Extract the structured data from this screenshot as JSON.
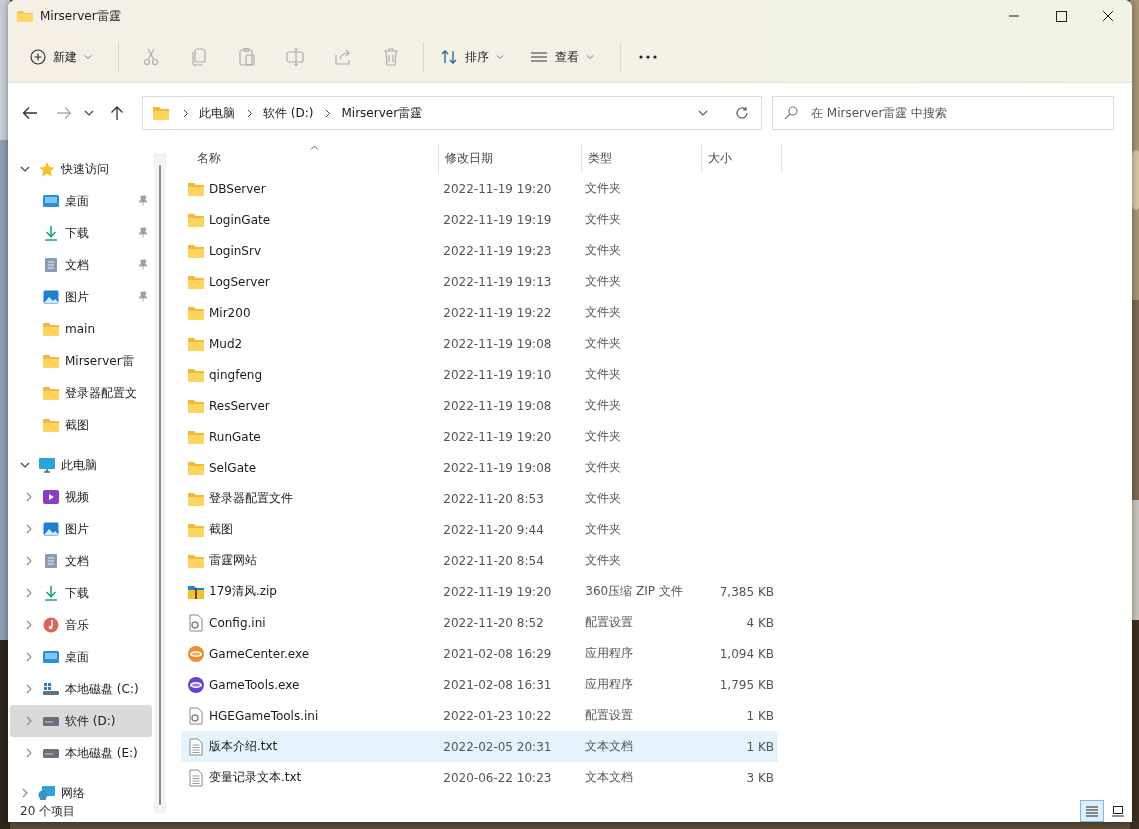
{
  "window": {
    "title": "Mirserver雷霆"
  },
  "toolbar": {
    "items": [
      {
        "kind": "new",
        "label": "新建",
        "disabled": false
      },
      {
        "kind": "cut",
        "disabled": true
      },
      {
        "kind": "copy",
        "disabled": true
      },
      {
        "kind": "paste",
        "disabled": true
      },
      {
        "kind": "rename",
        "disabled": true
      },
      {
        "kind": "share",
        "disabled": true
      },
      {
        "kind": "delete",
        "disabled": true
      },
      {
        "kind": "sort",
        "label": "排序",
        "disabled": false
      },
      {
        "kind": "view",
        "label": "查看",
        "disabled": false
      },
      {
        "kind": "more"
      }
    ]
  },
  "navigation": {
    "back_disabled": false,
    "forward_disabled": true,
    "breadcrumb": [
      "此电脑",
      "软件 (D:)",
      "Mirserver雷霆"
    ],
    "search": {
      "placeholder": "在 Mirserver雷霆 中搜索"
    }
  },
  "sidebar": {
    "items": [
      {
        "kind": "star",
        "label": "快速访问",
        "expanded": true,
        "selected": false,
        "children": [
          {
            "kind": "desktop",
            "label": "桌面",
            "pinned": true,
            "selected": false
          },
          {
            "kind": "download",
            "label": "下载",
            "pinned": true,
            "selected": false
          },
          {
            "kind": "doc",
            "label": "文档",
            "pinned": true,
            "selected": false
          },
          {
            "kind": "picture",
            "label": "图片",
            "pinned": true,
            "selected": false
          },
          {
            "kind": "folder",
            "label": "main",
            "pinned": false,
            "selected": false
          },
          {
            "kind": "folder",
            "label": "Mirserver雷",
            "pinned": false,
            "selected": false
          },
          {
            "kind": "folder",
            "label": "登录器配置文",
            "pinned": false,
            "selected": false
          },
          {
            "kind": "folder",
            "label": "截图",
            "pinned": false,
            "selected": false
          }
        ]
      },
      {
        "kind": "pc",
        "label": "此电脑",
        "expanded": true,
        "selected": false,
        "children": [
          {
            "kind": "video",
            "label": "视频",
            "expanded": false,
            "selected": false
          },
          {
            "kind": "picture",
            "label": "图片",
            "expanded": false,
            "selected": false
          },
          {
            "kind": "doc",
            "label": "文档",
            "expanded": false,
            "selected": false
          },
          {
            "kind": "download",
            "label": "下载",
            "expanded": false,
            "selected": false
          },
          {
            "kind": "music",
            "label": "音乐",
            "expanded": false,
            "selected": false
          },
          {
            "kind": "desktop",
            "label": "桌面",
            "expanded": false,
            "selected": false
          },
          {
            "kind": "drive-c",
            "label": "本地磁盘 (C:)",
            "expanded": false,
            "selected": false
          },
          {
            "kind": "drive",
            "label": "软件 (D:)",
            "expanded": false,
            "selected": true
          },
          {
            "kind": "drive",
            "label": "本地磁盘 (E:)",
            "expanded": false,
            "selected": false
          }
        ]
      },
      {
        "kind": "network",
        "label": "网络",
        "expanded": false,
        "selected": false
      }
    ]
  },
  "file_list": {
    "columns": [
      {
        "label": "名称",
        "sorted": true
      },
      {
        "label": "修改日期",
        "sorted": false
      },
      {
        "label": "类型",
        "sorted": false
      },
      {
        "label": "大小",
        "sorted": false
      }
    ],
    "rows": [
      {
        "kind": "folder",
        "name": "DBServer",
        "modified": "2022-11-19 19:20",
        "type": "文件夹",
        "hovered": false
      },
      {
        "kind": "folder",
        "name": "LoginGate",
        "modified": "2022-11-19 19:19",
        "type": "文件夹",
        "hovered": false
      },
      {
        "kind": "folder",
        "name": "LoginSrv",
        "modified": "2022-11-19 19:23",
        "type": "文件夹",
        "hovered": false
      },
      {
        "kind": "folder",
        "name": "LogServer",
        "modified": "2022-11-19 19:13",
        "type": "文件夹",
        "hovered": false
      },
      {
        "kind": "folder",
        "name": "Mir200",
        "modified": "2022-11-19 19:22",
        "type": "文件夹",
        "hovered": false
      },
      {
        "kind": "folder",
        "name": "Mud2",
        "modified": "2022-11-19 19:08",
        "type": "文件夹",
        "hovered": false
      },
      {
        "kind": "folder",
        "name": "qingfeng",
        "modified": "2022-11-19 19:10",
        "type": "文件夹",
        "hovered": false
      },
      {
        "kind": "folder",
        "name": "ResServer",
        "modified": "2022-11-19 19:08",
        "type": "文件夹",
        "hovered": false
      },
      {
        "kind": "folder",
        "name": "RunGate",
        "modified": "2022-11-19 19:20",
        "type": "文件夹",
        "hovered": false
      },
      {
        "kind": "folder",
        "name": "SelGate",
        "modified": "2022-11-19 19:08",
        "type": "文件夹",
        "hovered": false
      },
      {
        "kind": "folder",
        "name": "登录器配置文件",
        "modified": "2022-11-20 8:53",
        "type": "文件夹",
        "hovered": false
      },
      {
        "kind": "folder",
        "name": "截图",
        "modified": "2022-11-20 9:44",
        "type": "文件夹",
        "hovered": false
      },
      {
        "kind": "folder",
        "name": "雷霆网站",
        "modified": "2022-11-20 8:54",
        "type": "文件夹",
        "hovered": false
      },
      {
        "kind": "zip",
        "name": "179清风.zip",
        "modified": "2022-11-19 19:20",
        "type": "360压缩 ZIP 文件",
        "size": "7,385 KB",
        "hovered": false
      },
      {
        "kind": "ini",
        "name": "Config.ini",
        "modified": "2022-11-20 8:52",
        "type": "配置设置",
        "size": "4 KB",
        "hovered": false
      },
      {
        "kind": "exe-orange",
        "name": "GameCenter.exe",
        "modified": "2021-02-08 16:29",
        "type": "应用程序",
        "size": "1,094 KB",
        "hovered": false
      },
      {
        "kind": "exe-purple",
        "name": "GameTools.exe",
        "modified": "2021-02-08 16:31",
        "type": "应用程序",
        "size": "1,795 KB",
        "hovered": false
      },
      {
        "kind": "ini",
        "name": "HGEGameTools.ini",
        "modified": "2022-01-23 10:22",
        "type": "配置设置",
        "size": "1 KB",
        "hovered": false
      },
      {
        "kind": "txt",
        "name": "版本介绍.txt",
        "modified": "2022-02-05 20:31",
        "type": "文本文档",
        "size": "1 KB",
        "hovered": true
      },
      {
        "kind": "txt",
        "name": "变量记录文本.txt",
        "modified": "2020-06-22 10:23",
        "type": "文本文档",
        "size": "3 KB",
        "hovered": false
      }
    ]
  },
  "status_bar": {
    "item_count": "20 个项目",
    "views": [
      {
        "kind": "details",
        "selected": true
      },
      {
        "kind": "tiles",
        "selected": false
      }
    ]
  }
}
